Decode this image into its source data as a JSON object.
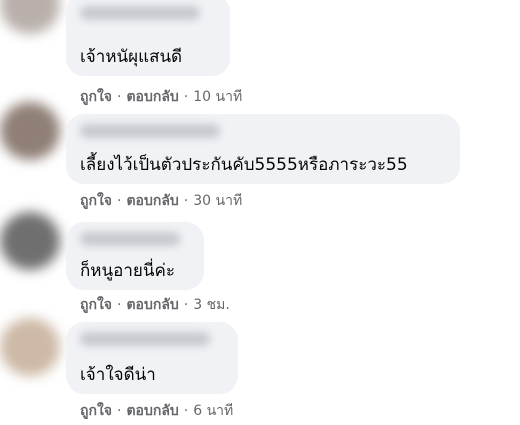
{
  "separator": "·",
  "comments": [
    {
      "text": "เจ้าหนัผุแสนดี",
      "like_label": "ถูกใจ",
      "reply_label": "ตอบกลับ",
      "time": "10 นาที",
      "avatar_color": "#b9b0ac"
    },
    {
      "text": "เลี้ยงไว้เป็นตัวประกันคับ5555หรือภาระวะ55",
      "like_label": "ถูกใจ",
      "reply_label": "ตอบกลับ",
      "time": "30 นาที",
      "avatar_color": "#8f7f76"
    },
    {
      "text": "ก็หนูอายนี่ค่ะ",
      "like_label": "ถูกใจ",
      "reply_label": "ตอบกลับ",
      "time": "3 ชม.",
      "avatar_color": "#6f6f6f"
    },
    {
      "text": "เจ้าใจดีน่า",
      "like_label": "ถูกใจ",
      "reply_label": "ตอบกลับ",
      "time": "6 นาที",
      "avatar_color": "#cdb9a6"
    }
  ]
}
